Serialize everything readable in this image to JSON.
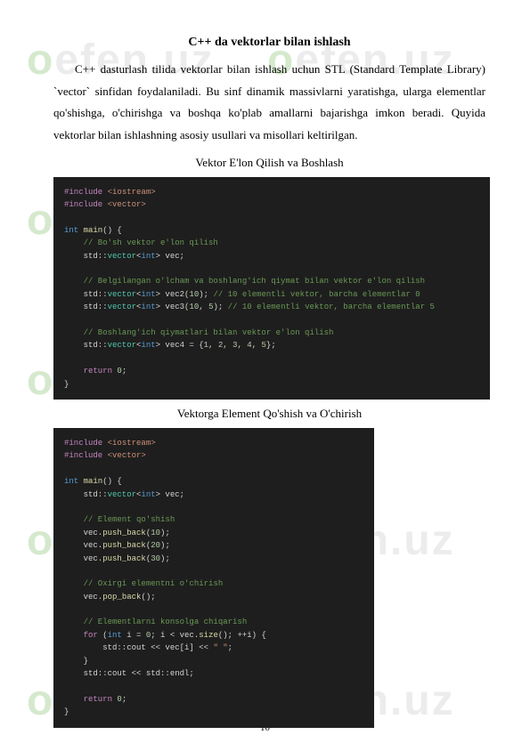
{
  "watermark": "oefen.uz",
  "title": "C++ da  vektorlar bilan ishlash",
  "paragraph": "C++ dasturlash tilida vektorlar bilan ishlash uchun STL (Standard Template Library) `vector` sinfidan foydalaniladi. Bu sinf dinamik massivlarni yaratishga, ularga elementlar qo'shishga, o'chirishga va boshqa ko'plab amallarni bajarishga imkon beradi. Quyida vektorlar bilan ishlashning asosiy usullari va misollari keltirilgan.",
  "subtitle1": "Vektor E'lon Qilish va Boshlash",
  "subtitle2": "Vektorga Element Qo'shish va O'chirish",
  "code1": {
    "l1a": "#include",
    "l1b": " <iostream>",
    "l2a": "#include",
    "l2b": " <vector>",
    "l4a": "int",
    "l4b": " main",
    "l4c": "() {",
    "l5": "    // Bo'sh vektor e'lon qilish",
    "l6a": "    std::",
    "l6b": "vector",
    "l6c": "<",
    "l6d": "int",
    "l6e": "> vec;",
    "l8": "    // Belgilangan o'lcham va boshlang'ich qiymat bilan vektor e'lon qilish",
    "l9a": "    std::",
    "l9b": "vector",
    "l9c": "<",
    "l9d": "int",
    "l9e": "> vec2(",
    "l9f": "10",
    "l9g": "); ",
    "l9h": "// 10 elementli vektor, barcha elementlar 0",
    "l10a": "    std::",
    "l10b": "vector",
    "l10c": "<",
    "l10d": "int",
    "l10e": "> vec3(",
    "l10f": "10",
    "l10g": ", ",
    "l10h": "5",
    "l10i": "); ",
    "l10j": "// 10 elementli vektor, barcha elementlar 5",
    "l12": "    // Boshlang'ich qiymatlari bilan vektor e'lon qilish",
    "l13a": "    std::",
    "l13b": "vector",
    "l13c": "<",
    "l13d": "int",
    "l13e": "> vec4 = {",
    "l13f": "1",
    "l13g": ", ",
    "l13h": "2",
    "l13i": ", ",
    "l13j": "3",
    "l13k": ", ",
    "l13l": "4",
    "l13m": ", ",
    "l13n": "5",
    "l13o": "};",
    "l15a": "    return",
    "l15b": " ",
    "l15c": "0",
    "l15d": ";",
    "l16": "}"
  },
  "code2": {
    "l1a": "#include",
    "l1b": " <iostream>",
    "l2a": "#include",
    "l2b": " <vector>",
    "l4a": "int",
    "l4b": " main",
    "l4c": "() {",
    "l5a": "    std::",
    "l5b": "vector",
    "l5c": "<",
    "l5d": "int",
    "l5e": "> vec;",
    "l7": "    // Element qo'shish",
    "l8a": "    vec.",
    "l8b": "push_back",
    "l8c": "(",
    "l8d": "10",
    "l8e": ");",
    "l9a": "    vec.",
    "l9b": "push_back",
    "l9c": "(",
    "l9d": "20",
    "l9e": ");",
    "l10a": "    vec.",
    "l10b": "push_back",
    "l10c": "(",
    "l10d": "30",
    "l10e": ");",
    "l12": "    // Oxirgi elementni o'chirish",
    "l13a": "    vec.",
    "l13b": "pop_back",
    "l13c": "();",
    "l15": "    // Elementlarni konsolga chiqarish",
    "l16a": "    for",
    "l16b": " (",
    "l16c": "int",
    "l16d": " i = ",
    "l16e": "0",
    "l16f": "; i < vec.",
    "l16g": "size",
    "l16h": "(); ++i) {",
    "l17a": "        std::cout << vec[i] << ",
    "l17b": "\" \"",
    "l17c": ";",
    "l18": "    }",
    "l19": "    std::cout << std::endl;",
    "l21a": "    return",
    "l21b": " ",
    "l21c": "0",
    "l21d": ";",
    "l22": "}"
  },
  "pageNumber": "10"
}
